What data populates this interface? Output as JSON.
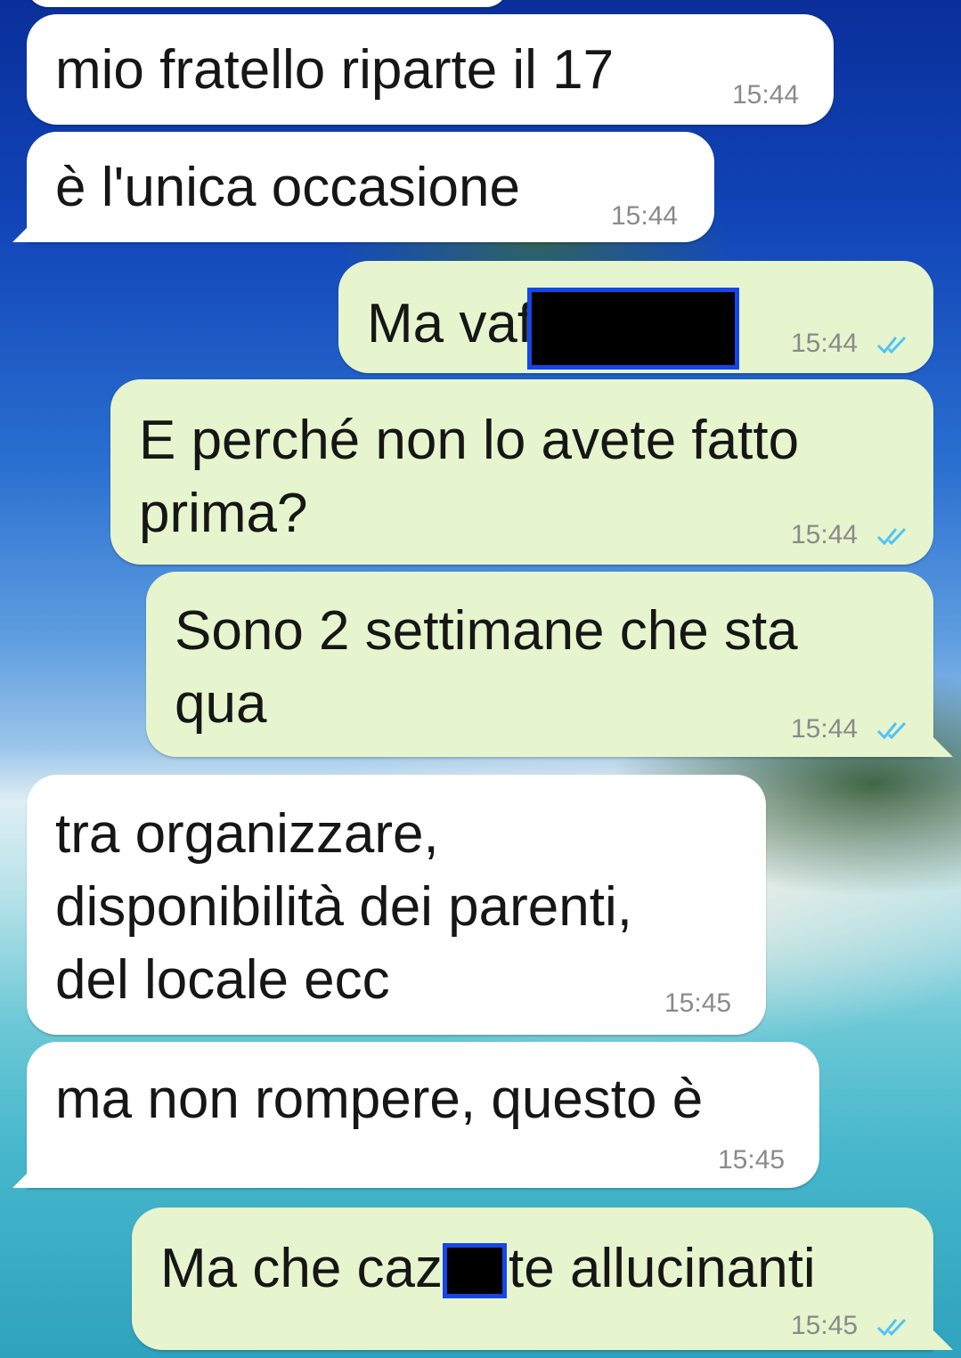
{
  "chat": {
    "messages": [
      {
        "id": "m1",
        "direction": "in",
        "text": "mio fratello riparte il 17",
        "time": "15:44"
      },
      {
        "id": "m2",
        "direction": "in",
        "text": "è l'unica occasione",
        "time": "15:44"
      },
      {
        "id": "m3",
        "direction": "out",
        "text_before": "Ma vaf",
        "redacted": true,
        "time": "15:44",
        "read": true
      },
      {
        "id": "m4",
        "direction": "out",
        "line1": "E perché non lo avete fatto",
        "line2": "prima?",
        "time": "15:44",
        "read": true
      },
      {
        "id": "m5",
        "direction": "out",
        "line1": "Sono 2 settimane che sta",
        "line2": "qua",
        "time": "15:44",
        "read": true
      },
      {
        "id": "m6",
        "direction": "in",
        "line1": "tra organizzare,",
        "line2": "disponibilità dei parenti,",
        "line3": "del locale ecc",
        "time": "15:45"
      },
      {
        "id": "m7",
        "direction": "in",
        "text": "ma non rompere, questo è",
        "time": "15:45"
      },
      {
        "id": "m8",
        "direction": "out",
        "text_before": "Ma che caz",
        "text_after": "te allucinanti",
        "redacted": true,
        "time": "15:45",
        "read": true
      }
    ]
  },
  "colors": {
    "incoming_bubble": "#ffffff",
    "outgoing_bubble": "#e6f5cd",
    "read_tick": "#4fc3f7",
    "redaction_border": "#1546e8"
  },
  "icons": {
    "read_receipt": "double-check-icon"
  }
}
